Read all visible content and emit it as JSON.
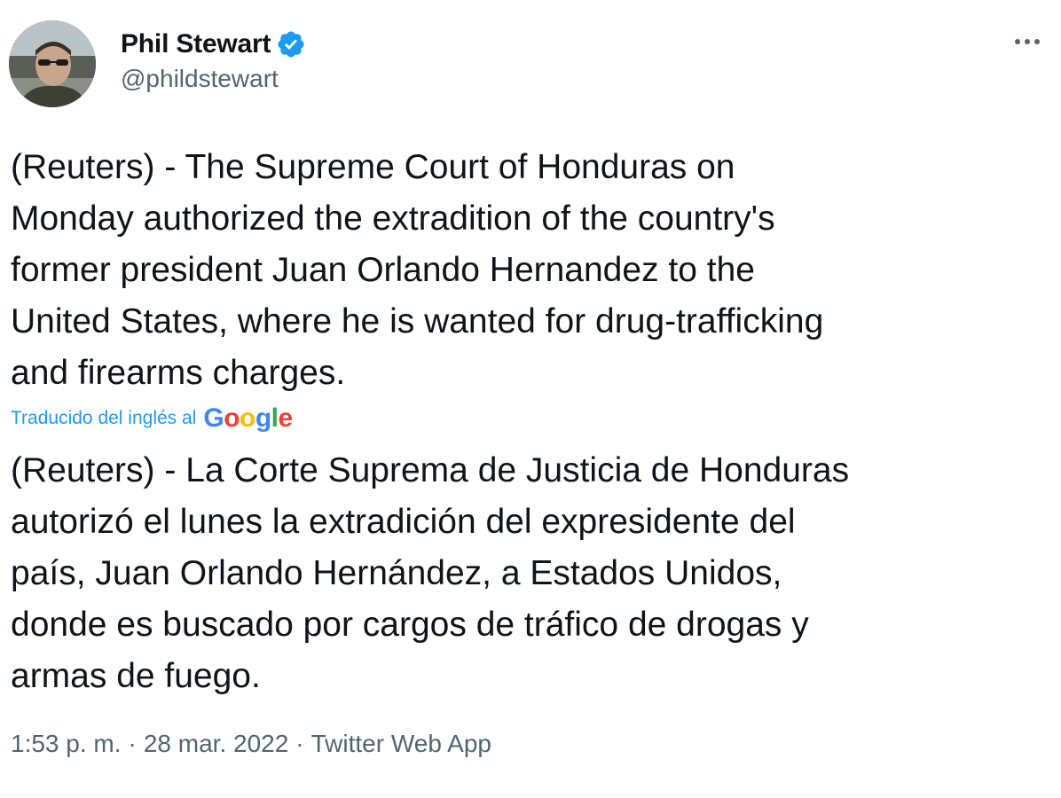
{
  "author": {
    "name": "Phil Stewart",
    "handle": "@phildstewart",
    "verified_icon": "verified-badge-icon",
    "verified_color": "#1d9bf0"
  },
  "more_menu": {
    "icon": "more-options-icon"
  },
  "tweet": {
    "text": "(Reuters) - The Supreme Court of Honduras on\nMonday authorized the extradition of the country's\nformer president Juan Orlando Hernandez to the\nUnited States, where he is wanted for drug-trafficking\nand firearms charges."
  },
  "translation": {
    "label": "Traducido del inglés al",
    "provider": "Google",
    "provider_letters": [
      {
        "ch": "G",
        "color": "#4285f4"
      },
      {
        "ch": "o",
        "color": "#ea4335"
      },
      {
        "ch": "o",
        "color": "#fbbc05"
      },
      {
        "ch": "g",
        "color": "#4285f4"
      },
      {
        "ch": "l",
        "color": "#34a853"
      },
      {
        "ch": "e",
        "color": "#ea4335"
      }
    ],
    "text": "(Reuters) - La Corte Suprema de Justicia de Honduras\nautorizó el lunes la extradición del expresidente del\npaís, Juan Orlando Hernández, a Estados Unidos,\ndonde es buscado por cargos de tráfico de drogas y\narmas de fuego."
  },
  "meta": {
    "time": "1:53 p. m.",
    "date": "28 mar. 2022",
    "source": "Twitter Web App",
    "separator": "·"
  },
  "colors": {
    "text": "#0f1419",
    "secondary": "#536471",
    "link": "#1d9bf0"
  }
}
